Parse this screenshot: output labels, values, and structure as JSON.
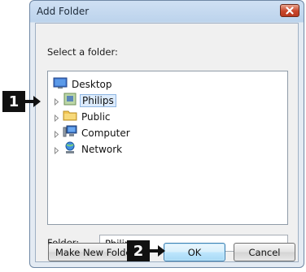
{
  "window": {
    "title": "Add Folder",
    "close_label": "×"
  },
  "dialog": {
    "prompt": "Select a folder:",
    "tree": [
      {
        "label": "Desktop",
        "icon": "desktop-icon"
      },
      {
        "label": "Philips",
        "icon": "user-folder-icon",
        "selected": true
      },
      {
        "label": "Public",
        "icon": "folder-icon"
      },
      {
        "label": "Computer",
        "icon": "computer-icon"
      },
      {
        "label": "Network",
        "icon": "network-icon"
      }
    ],
    "folder_label": "Folder:",
    "folder_value": "Philips",
    "buttons": {
      "make_new_folder": "Make New Folder",
      "ok": "OK",
      "cancel": "Cancel"
    }
  },
  "callouts": {
    "step1": "1",
    "step2": "2"
  },
  "colors": {
    "accent": "#3c7fb1",
    "callout": "#111111",
    "close": "#c8452a"
  }
}
